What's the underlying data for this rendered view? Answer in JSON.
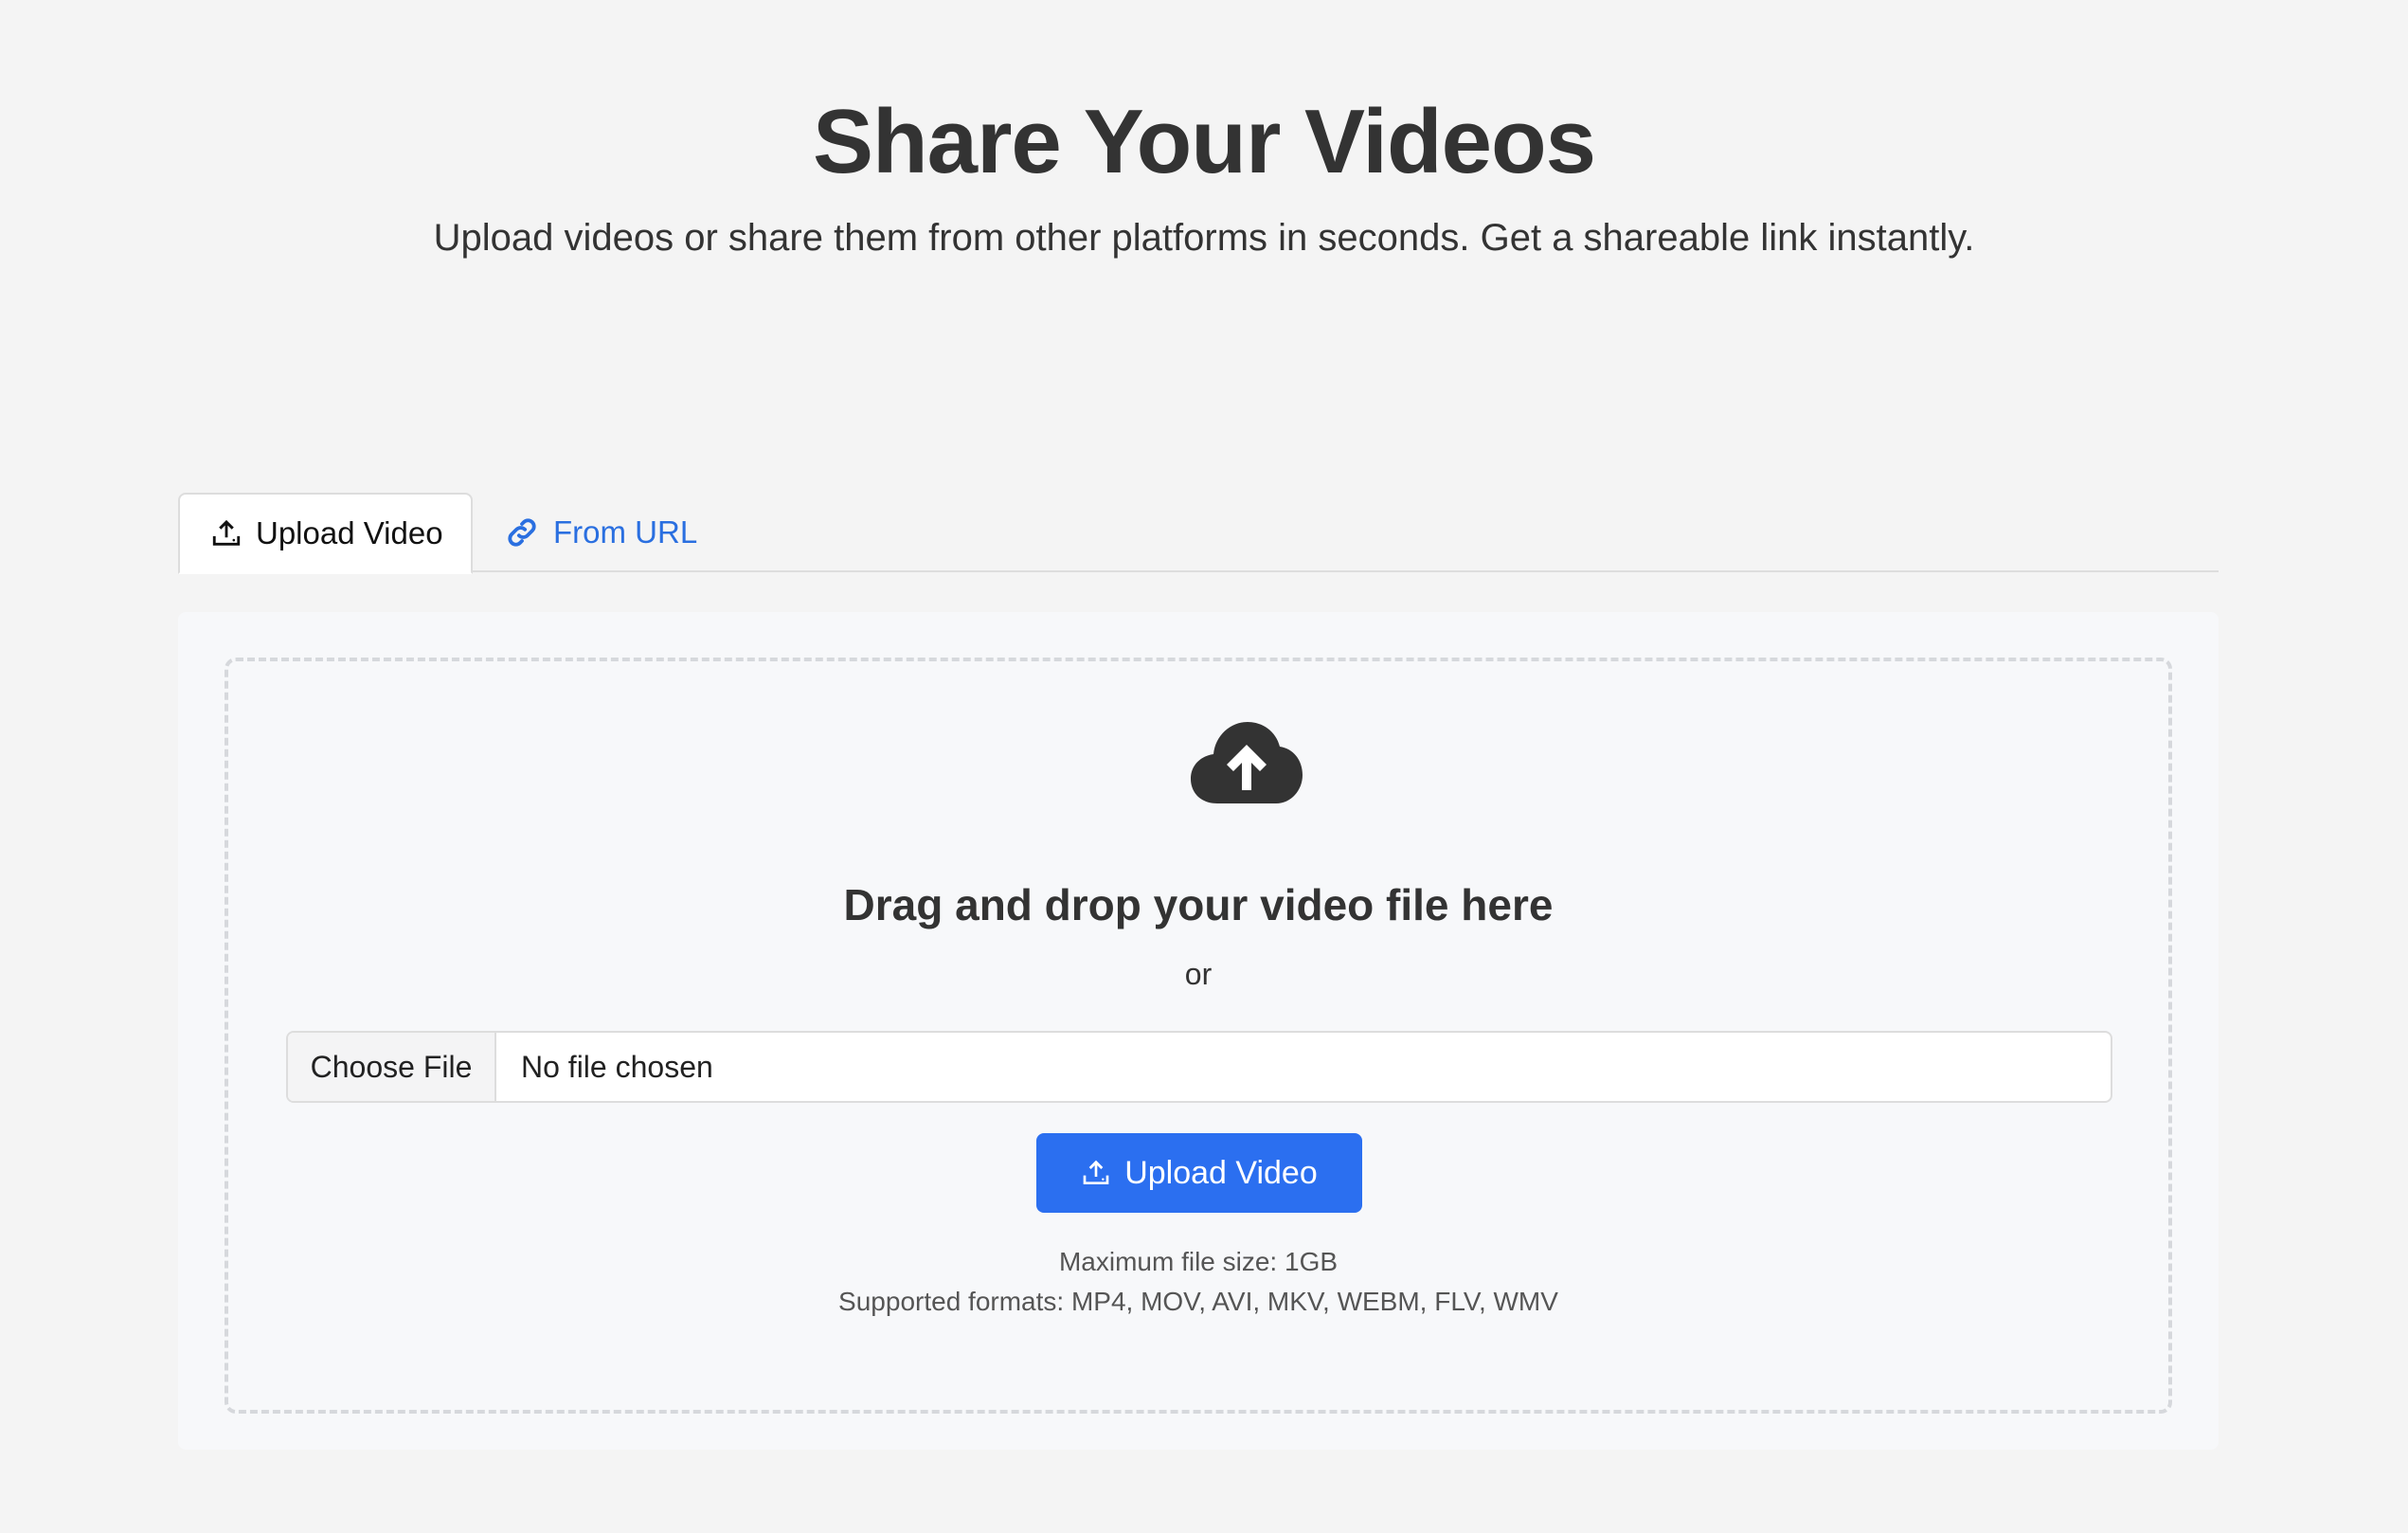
{
  "header": {
    "title": "Share Your Videos",
    "subtitle": "Upload videos or share them from other platforms in seconds. Get a shareable link instantly."
  },
  "tabs": [
    {
      "label": "Upload Video",
      "icon": "upload-icon",
      "active": true
    },
    {
      "label": "From URL",
      "icon": "link-icon",
      "active": false
    }
  ],
  "dropzone": {
    "icon": "cloud-upload-icon",
    "title": "Drag and drop your video file here",
    "or_text": "or",
    "file_input": {
      "button_label": "Choose File",
      "status": "No file chosen"
    },
    "upload_button": {
      "label": "Upload Video",
      "icon": "upload-icon"
    },
    "max_size": "Maximum file size: 1GB",
    "formats": "Supported formats: MP4, MOV, AVI, MKV, WEBM, FLV, WMV"
  },
  "colors": {
    "accent": "#2b6ff0",
    "link": "#2a6fe0",
    "background": "#f4f4f4",
    "panel": "#f7f8fa",
    "text": "#333333"
  }
}
